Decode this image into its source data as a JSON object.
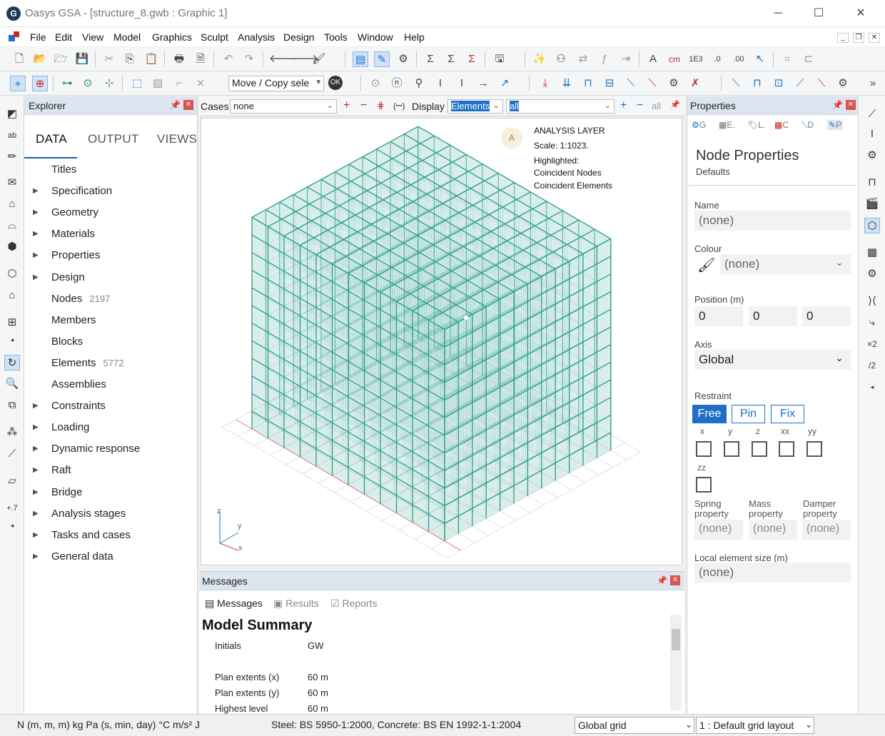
{
  "window": {
    "title": "Oasys GSA - [structure_8.gwb : Graphic 1]",
    "app_icon_letter": "G",
    "minimize": "─",
    "maximize": "☐",
    "close": "✕"
  },
  "menu": [
    "File",
    "Edit",
    "View",
    "Model",
    "Graphics",
    "Sculpt",
    "Analysis",
    "Design",
    "Tools",
    "Window",
    "Help"
  ],
  "toolbar2": {
    "move_copy_value": "Move / Copy sele",
    "ok_label": "OK"
  },
  "explorer": {
    "title": "Explorer",
    "tabs": [
      "DATA",
      "OUTPUT",
      "VIEWS"
    ],
    "items": [
      {
        "label": "Titles",
        "expandable": false,
        "count": ""
      },
      {
        "label": "Specification",
        "expandable": true,
        "count": ""
      },
      {
        "label": "Geometry",
        "expandable": true,
        "count": ""
      },
      {
        "label": "Materials",
        "expandable": true,
        "count": ""
      },
      {
        "label": "Properties",
        "expandable": true,
        "count": ""
      },
      {
        "label": "Design",
        "expandable": true,
        "count": ""
      },
      {
        "label": "Nodes",
        "expandable": false,
        "count": "2197"
      },
      {
        "label": "Members",
        "expandable": false,
        "count": ""
      },
      {
        "label": "Blocks",
        "expandable": false,
        "count": ""
      },
      {
        "label": "Elements",
        "expandable": false,
        "count": "5772"
      },
      {
        "label": "Assemblies",
        "expandable": false,
        "count": ""
      },
      {
        "label": "Constraints",
        "expandable": true,
        "count": ""
      },
      {
        "label": "Loading",
        "expandable": true,
        "count": ""
      },
      {
        "label": "Dynamic response",
        "expandable": true,
        "count": ""
      },
      {
        "label": "Raft",
        "expandable": true,
        "count": ""
      },
      {
        "label": "Bridge",
        "expandable": true,
        "count": ""
      },
      {
        "label": "Analysis stages",
        "expandable": true,
        "count": ""
      },
      {
        "label": "Tasks and cases",
        "expandable": true,
        "count": ""
      },
      {
        "label": "General data",
        "expandable": true,
        "count": ""
      }
    ]
  },
  "cases_bar": {
    "cases_label": "Cases",
    "cases_value": "none",
    "display_label": "Display",
    "display_value": "Elements",
    "filter_value": "all",
    "all_label": "all"
  },
  "graphic": {
    "layer_avatar": "A",
    "layer_lines": [
      "ANALYSIS LAYER",
      "Scale: 1:1023.",
      "Highlighted:",
      "Coincident Nodes",
      "Coincident Elements"
    ],
    "axes": {
      "x": "x",
      "y": "y",
      "z": "z"
    },
    "frame_color": "#2a9d8f"
  },
  "messages": {
    "title": "Messages",
    "tabs": [
      "Messages",
      "Results",
      "Reports"
    ],
    "heading": "Model Summary",
    "rows": [
      {
        "key": "Initials",
        "value": "GW"
      },
      {
        "key": "Plan extents (x)",
        "value": "60 m"
      },
      {
        "key": "Plan extents (y)",
        "value": "60 m"
      },
      {
        "key": "Highest level",
        "value": "60 m"
      }
    ]
  },
  "properties": {
    "title": "Properties",
    "tab_letters": [
      "G",
      "E.",
      "L.",
      "C",
      "D",
      "P"
    ],
    "heading": "Node Properties",
    "subheading": "Defaults",
    "name_label": "Name",
    "name_value": "(none)",
    "colour_label": "Colour",
    "colour_value": "(none)",
    "position_label": "Position (m)",
    "position": [
      "0",
      "0",
      "0"
    ],
    "axis_label": "Axis",
    "axis_value": "Global",
    "restraint_label": "Restraint",
    "restraint_buttons": [
      "Free",
      "Pin",
      "Fix"
    ],
    "restraint_dofs": [
      "x",
      "y",
      "z",
      "xx",
      "yy",
      "zz"
    ],
    "spring_label": "Spring property",
    "mass_label": "Mass property",
    "damper_label": "Damper property",
    "spring_value": "(none)",
    "mass_value": "(none)",
    "damper_value": "(none)",
    "local_size_label": "Local element size (m)",
    "local_size_value": "(none)"
  },
  "status": {
    "units": "N  (m, m, m)  kg  Pa  (s, min, day)  °C  m/s²  J",
    "codes": "Steel: BS 5950-1:2000, Concrete: BS EN 1992-1-1:2004",
    "grid": "Global grid",
    "layout": "1 : Default grid layout"
  },
  "colors": {
    "accent": "#1f6fc8",
    "panel_header": "#dde6f0"
  }
}
